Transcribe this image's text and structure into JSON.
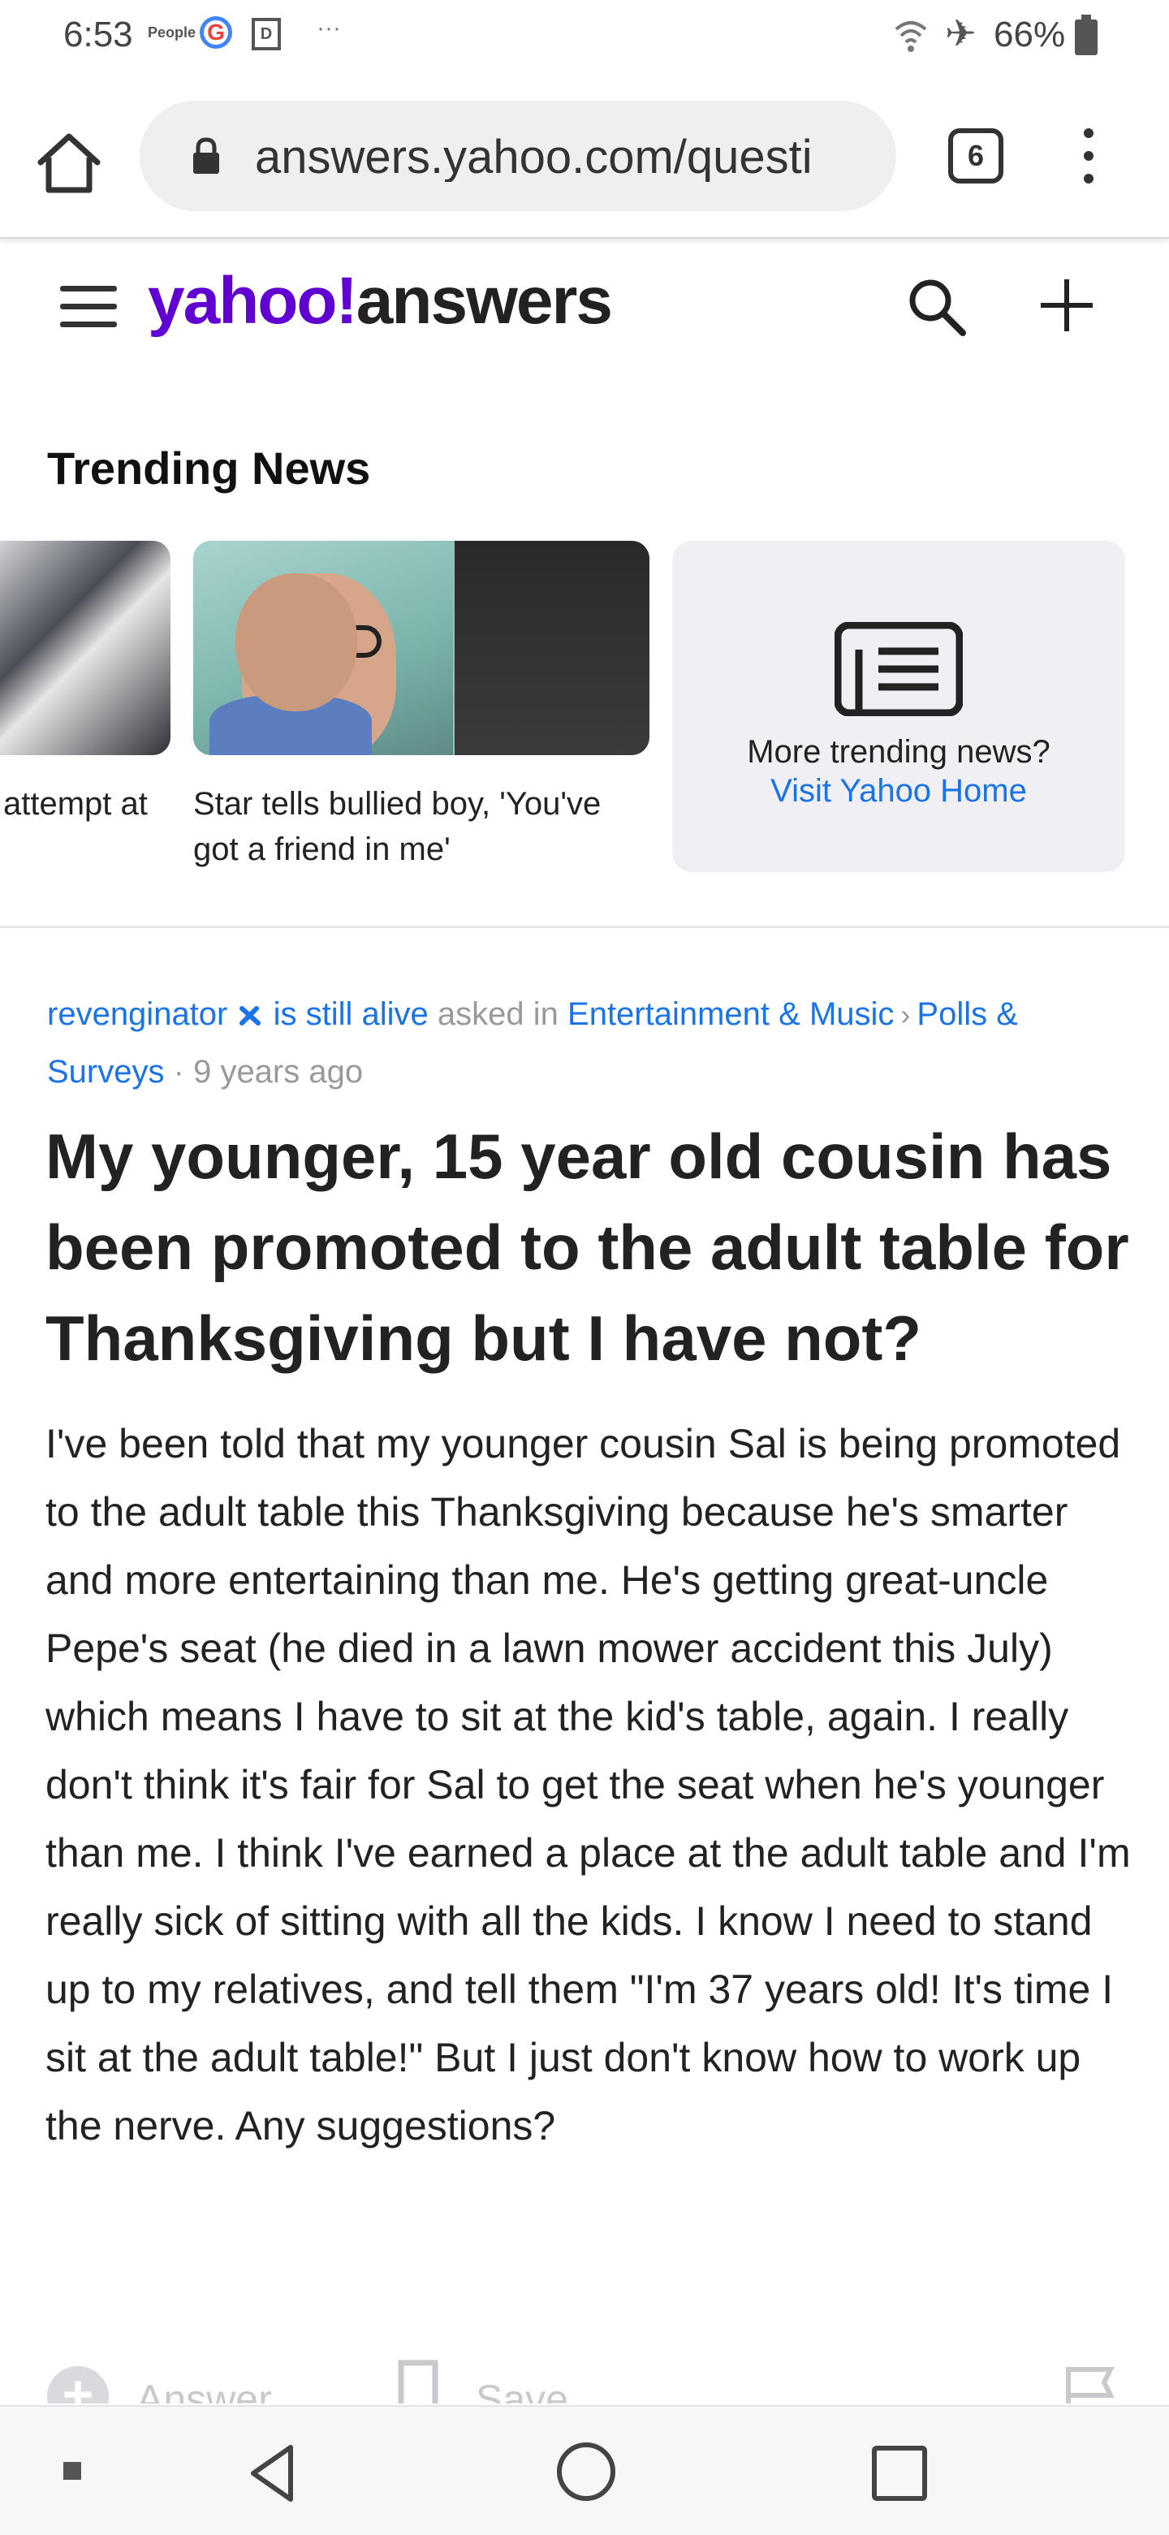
{
  "status_bar": {
    "time": "6:53",
    "people_label": "People",
    "g_label": "G",
    "box_label": "D",
    "more": "···",
    "battery": "66%"
  },
  "browser": {
    "url": "answers.yahoo.com/questi",
    "tab_count": "6"
  },
  "header": {
    "logo_yahoo": "yahoo!",
    "logo_answers": "answers"
  },
  "trending": {
    "title": "Trending News",
    "cards": [
      {
        "caption": "attempt at"
      },
      {
        "caption": "Star tells bullied boy, 'You've got a friend in me'"
      }
    ],
    "more_text": "More trending news?",
    "more_link": "Visit Yahoo Home"
  },
  "question": {
    "user": "revenginator",
    "user_suffix": "is still alive",
    "asked_in": "asked in",
    "category": "Entertainment & Music",
    "subcategory": "Polls & Surveys",
    "separator": "·",
    "time_ago": "9 years ago",
    "title": "My younger, 15 year old cousin has been promoted to the adult table for Thanksgiving but I have not?",
    "body": "I've been told that my younger cousin Sal is being promoted to the adult table this Thanksgiving because he's smarter and more entertaining than me. He's getting great-uncle Pepe's seat (he died in a lawn mower accident this July) which means I have to sit at the kid's table, again.  I really don't think it's fair for Sal to get the seat when he's younger than me. I think I've earned a place at the adult table and I'm really sick of sitting with all the kids.  I know I need to stand up to my relatives, and tell them \"I'm 37 years old! It's time I sit at the adult table!\"  But I just don't know how to work up the nerve.  Any suggestions?"
  },
  "actions": {
    "answer_label": "Answer",
    "save_label": "Save"
  },
  "colors": {
    "yahoo_purple": "#6001d2",
    "link_blue": "#1a73e8"
  }
}
